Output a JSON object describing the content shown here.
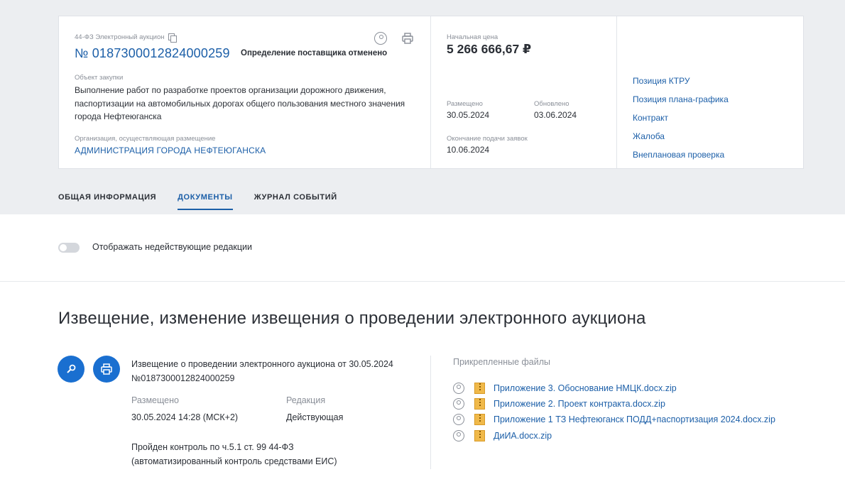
{
  "procurement": {
    "law_type": "44-ФЗ Электронный аукцион",
    "number": "№ 0187300012824000259",
    "status": "Определение поставщика отменено",
    "object_label": "Объект закупки",
    "object_text": "Выполнение работ по разработке проектов организации дорожного движения, паспортизации на автомобильных дорогах общего пользования местного значения города Нефтеюганска",
    "org_label": "Организация, осуществляющая размещение",
    "org_name": "АДМИНИСТРАЦИЯ ГОРОДА НЕФТЕЮГАНСКА"
  },
  "price": {
    "label": "Начальная цена",
    "value": "5 266 666,67 ₽"
  },
  "dates": {
    "published_label": "Размещено",
    "published_value": "30.05.2024",
    "updated_label": "Обновлено",
    "updated_value": "03.06.2024",
    "deadline_label": "Окончание подачи заявок",
    "deadline_value": "10.06.2024"
  },
  "side_links": [
    "Позиция КТРУ",
    "Позиция плана-графика",
    "Контракт",
    "Жалоба",
    "Внеплановая проверка"
  ],
  "tabs": [
    {
      "label": "ОБЩАЯ ИНФОРМАЦИЯ",
      "active": false
    },
    {
      "label": "ДОКУМЕНТЫ",
      "active": true
    },
    {
      "label": "ЖУРНАЛ СОБЫТИЙ",
      "active": false
    }
  ],
  "toggle": {
    "label": "Отображать недействующие редакции",
    "on": false
  },
  "section": {
    "title": "Извещение, изменение извещения о проведении электронного аукциона"
  },
  "notice": {
    "title_line1": "Извещение о проведении электронного аукциона от 30.05.2024",
    "title_line2": "№0187300012824000259",
    "placed_label": "Размещено",
    "placed_value": "30.05.2024 14:28 (МСК+2)",
    "edition_label": "Редакция",
    "edition_value": "Действующая",
    "control_line1": "Пройден контроль по ч.5.1 ст. 99 44-ФЗ",
    "control_line2": "(автоматизированный контроль средствами ЕИС)"
  },
  "attachments": {
    "label": "Прикрепленные файлы",
    "files": [
      "Приложение 3. Обоснование НМЦК.docx.zip",
      "Приложение 2. Проект контракта.docx.zip",
      "Приложение 1 ТЗ Нефтеюганск ПОДД+паспортизация 2024.docx.zip",
      "ДиИА.docx.zip"
    ]
  },
  "colors": {
    "accent": "#1c5fa8",
    "button_blue": "#1a6fd0",
    "header_bg": "#eceef1"
  },
  "icons": [
    "copy-icon",
    "search-icon",
    "print-icon",
    "zip-file-icon"
  ]
}
